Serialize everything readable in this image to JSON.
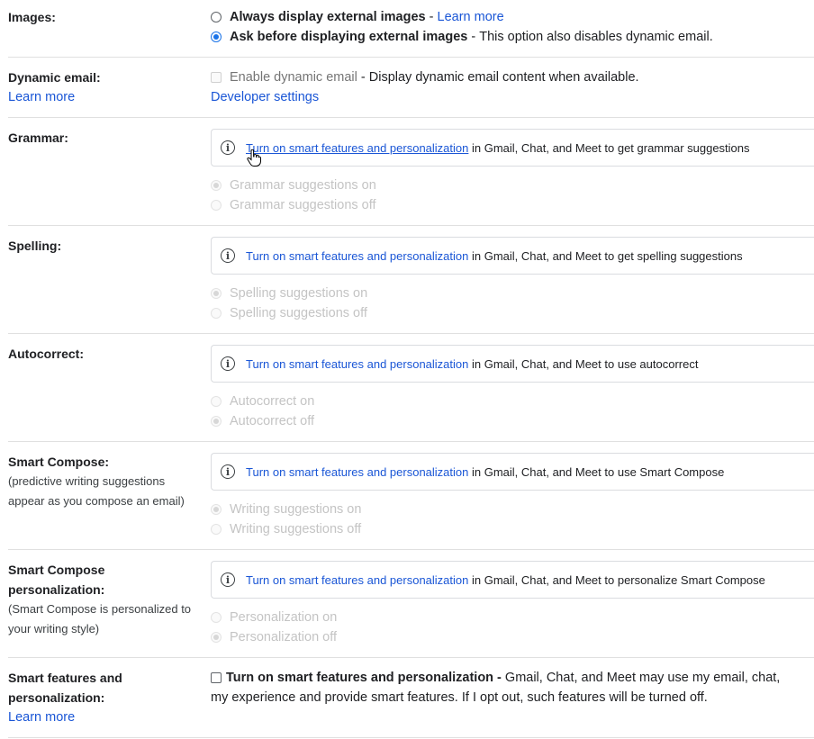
{
  "settings": {
    "images": {
      "label": "Images:",
      "options": [
        {
          "bold": "Always display external images",
          "sep": " - ",
          "link": "Learn more",
          "checked": false
        },
        {
          "bold": "Ask before displaying external images",
          "sep": " - ",
          "desc": "This option also disables dynamic email.",
          "checked": true
        }
      ]
    },
    "dynamic_email": {
      "label": "Dynamic email:",
      "learn_more": "Learn more",
      "checkbox_label": "Enable dynamic email",
      "checkbox_desc": " - Display dynamic email content when available.",
      "checked": false,
      "developer_settings": "Developer settings"
    },
    "info_link": "Turn on smart features and personalization",
    "grammar": {
      "label": "Grammar:",
      "info_suffix": " in Gmail, Chat, and Meet to get grammar suggestions",
      "options": [
        {
          "label": "Grammar suggestions on",
          "checked": true
        },
        {
          "label": "Grammar suggestions off",
          "checked": false
        }
      ]
    },
    "spelling": {
      "label": "Spelling:",
      "info_suffix": " in Gmail, Chat, and Meet to get spelling suggestions",
      "options": [
        {
          "label": "Spelling suggestions on",
          "checked": true
        },
        {
          "label": "Spelling suggestions off",
          "checked": false
        }
      ]
    },
    "autocorrect": {
      "label": "Autocorrect:",
      "info_suffix": " in Gmail, Chat, and Meet to use autocorrect",
      "options": [
        {
          "label": "Autocorrect on",
          "checked": false
        },
        {
          "label": "Autocorrect off",
          "checked": true
        }
      ]
    },
    "smart_compose": {
      "label": "Smart Compose:",
      "sub": "(predictive writing suggestions appear as you compose an email)",
      "info_suffix": " in Gmail, Chat, and Meet to use Smart Compose",
      "options": [
        {
          "label": "Writing suggestions on",
          "checked": true
        },
        {
          "label": "Writing suggestions off",
          "checked": false
        }
      ]
    },
    "smart_compose_personalization": {
      "label": "Smart Compose personalization:",
      "sub": "(Smart Compose is personalized to your writing style)",
      "info_suffix": " in Gmail, Chat, and Meet to personalize Smart Compose",
      "options": [
        {
          "label": "Personalization on",
          "checked": false
        },
        {
          "label": "Personalization off",
          "checked": true
        }
      ]
    },
    "smart_features": {
      "label": "Smart features and personalization:",
      "learn_more": "Learn more",
      "checkbox_bold": "Turn on smart features and personalization -",
      "checkbox_desc": " Gmail, Chat, and Meet may use my email, chat,",
      "line2": "my experience and provide smart features. If I opt out, such features will be turned off.",
      "checked": false
    }
  }
}
